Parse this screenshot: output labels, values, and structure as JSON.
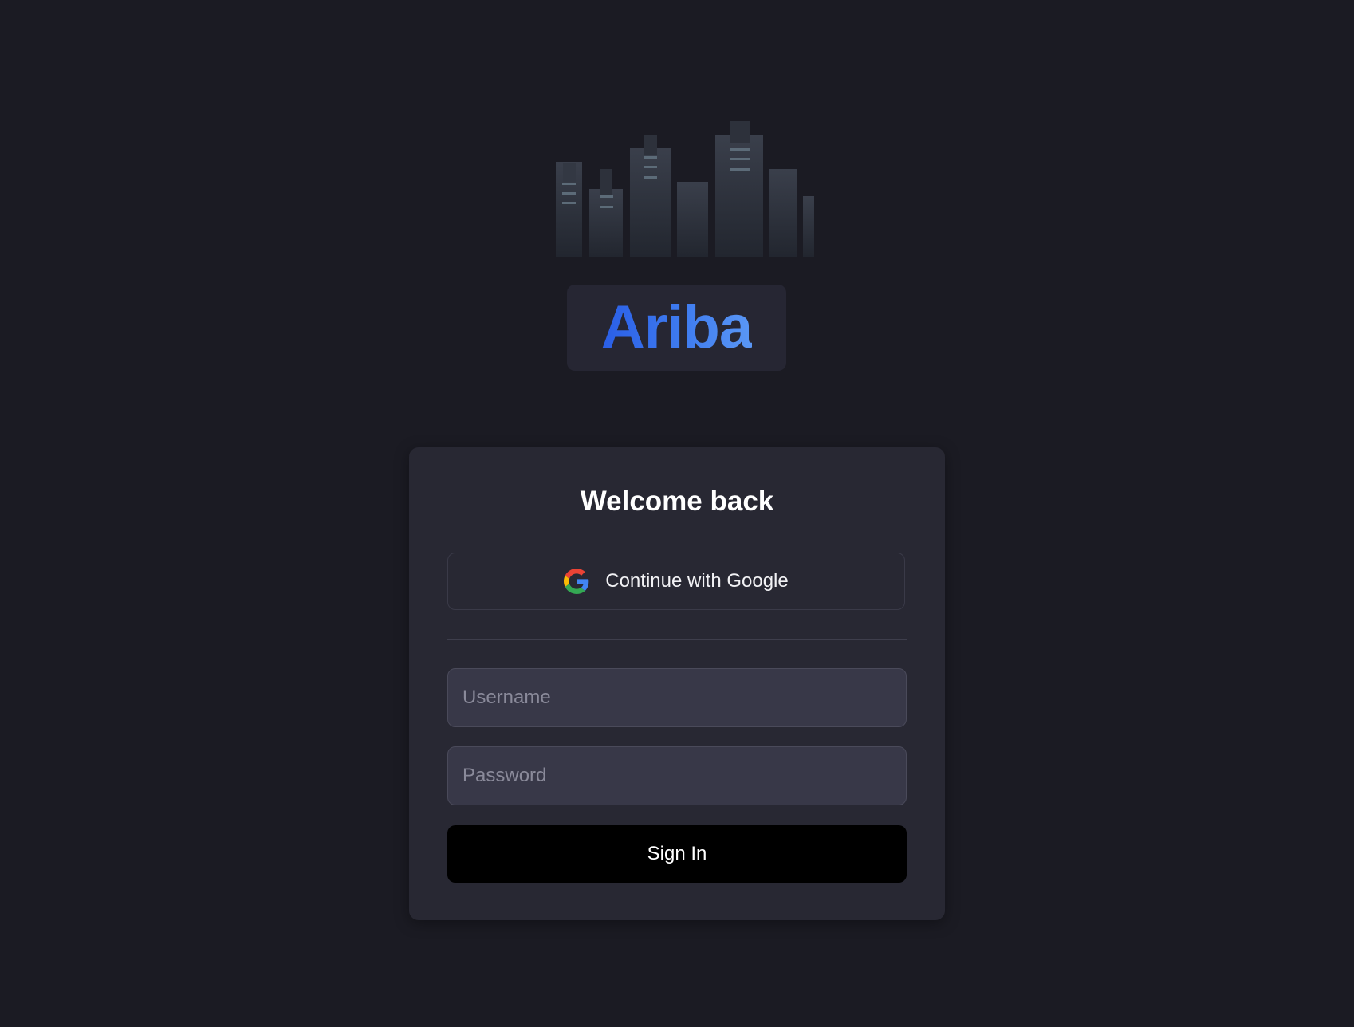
{
  "brand": {
    "logo_icon": "city-skyline-icon",
    "name": "Ariba",
    "accent_color": "#3a74ee"
  },
  "login": {
    "title": "Welcome back",
    "google_button_label": "Continue with Google",
    "google_icon": "google-g-icon",
    "username_placeholder": "Username",
    "username_value": "",
    "password_placeholder": "Password",
    "password_value": "",
    "signin_label": "Sign In"
  },
  "colors": {
    "background": "#1b1b23",
    "card": "#282833",
    "input": "#383848",
    "signin_button": "#000000"
  }
}
